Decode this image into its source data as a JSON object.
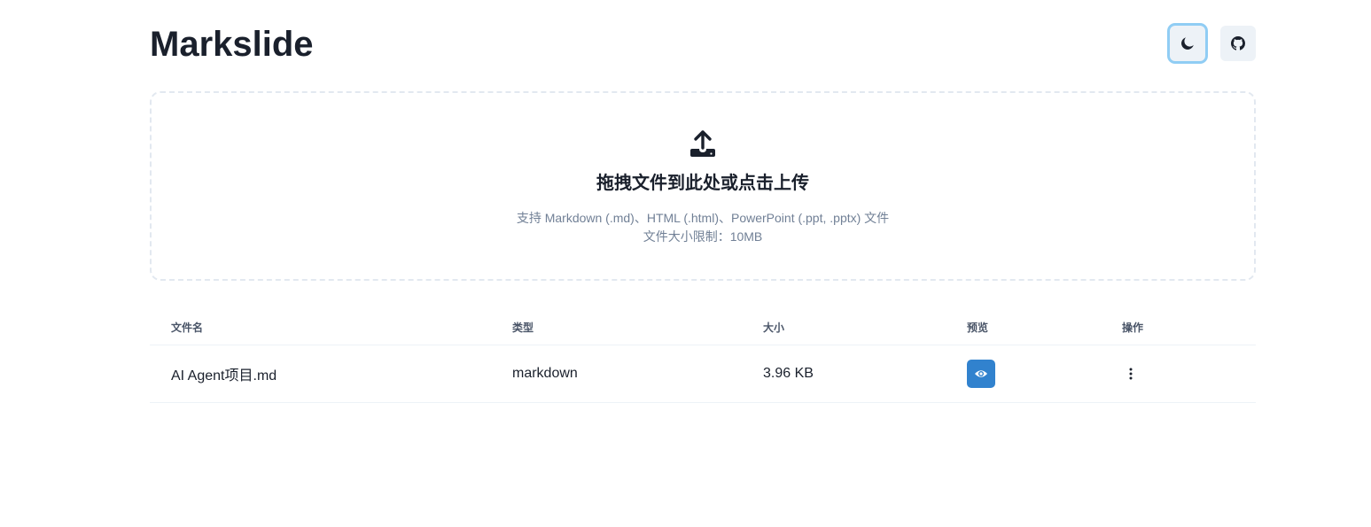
{
  "app": {
    "title": "Markslide"
  },
  "header": {
    "theme_toggle_icon": "moon-icon",
    "github_icon": "github-icon"
  },
  "upload": {
    "icon": "upload-icon",
    "title": "拖拽文件到此处或点击上传",
    "supported": "支持 Markdown (.md)、HTML (.html)、PowerPoint (.ppt, .pptx) 文件",
    "size_limit": "文件大小限制：10MB"
  },
  "table": {
    "headers": {
      "name": "文件名",
      "type": "类型",
      "size": "大小",
      "preview": "预览",
      "actions": "操作"
    },
    "rows": [
      {
        "name": "AI Agent项目.md",
        "type": "markdown",
        "size": "3.96 KB",
        "preview_icon": "eye-icon",
        "actions_icon": "more-vertical-icon"
      }
    ]
  },
  "colors": {
    "accent": "#3182ce",
    "focus_ring": "#90cdf4",
    "button_bg": "#edf2f7",
    "text": "#1a202c",
    "muted": "#718096"
  }
}
